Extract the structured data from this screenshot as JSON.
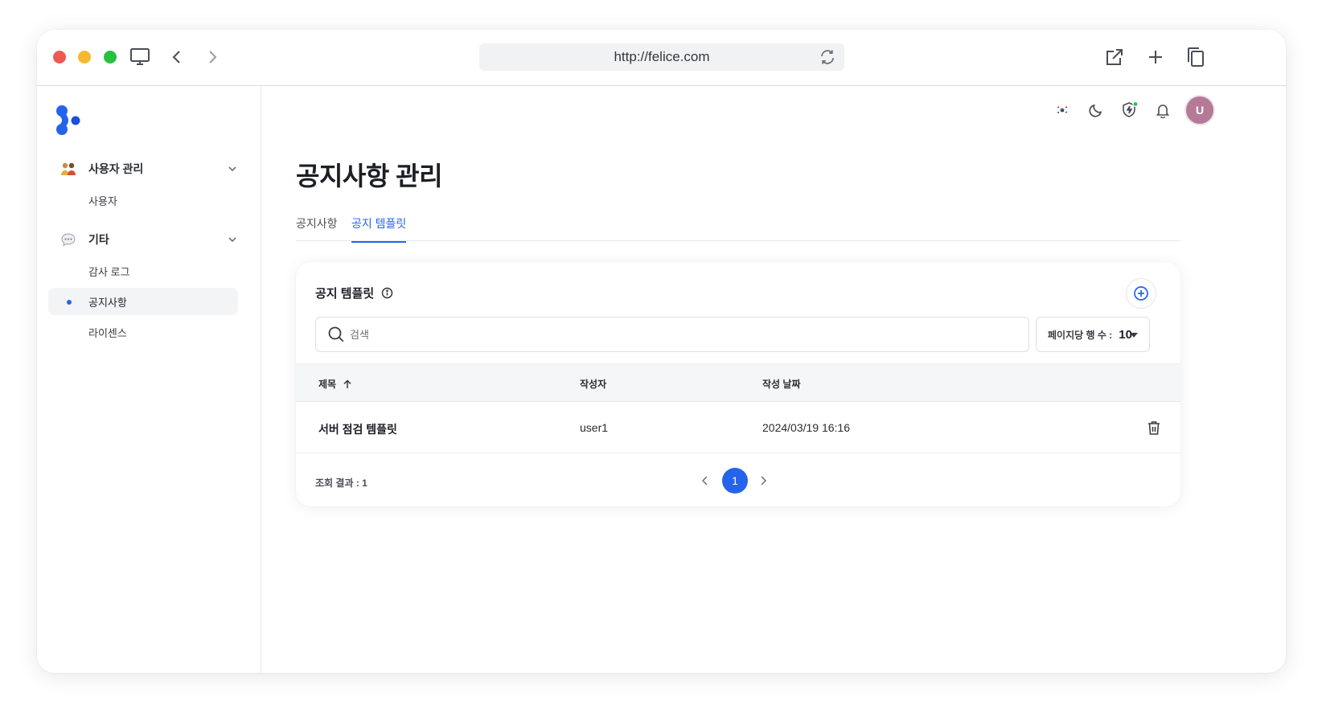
{
  "browser": {
    "url": "http://felice.com",
    "traffic_colors": {
      "close": "#ee5a52",
      "minimize": "#f5b92f",
      "maximize": "#27c03f"
    }
  },
  "sidebar": {
    "groups": [
      {
        "label": "사용자 관리",
        "icon": "people-icon",
        "items": [
          {
            "label": "사용자",
            "active": false
          }
        ]
      },
      {
        "label": "기타",
        "icon": "chat-bubble-icon",
        "items": [
          {
            "label": "감사 로그",
            "active": false
          },
          {
            "label": "공지사항",
            "active": true
          },
          {
            "label": "라이센스",
            "active": false
          }
        ]
      }
    ]
  },
  "header": {
    "avatar_initial": "U",
    "icons": [
      "korea-flag-icon",
      "moon-icon",
      "shield-icon",
      "bell-icon"
    ]
  },
  "page": {
    "title": "공지사항 관리",
    "tabs": [
      {
        "label": "공지사항",
        "active": false
      },
      {
        "label": "공지 템플릿",
        "active": true
      }
    ]
  },
  "card": {
    "title": "공지 템플릿",
    "search_placeholder": "검색",
    "rows_per_page_label": "페이지당 행 수 :",
    "rows_per_page_value": "10",
    "columns": [
      "제목",
      "작성자",
      "작성 날짜"
    ],
    "rows": [
      {
        "title": "서버 점검 템플릿",
        "author": "user1",
        "date": "2024/03/19 16:16"
      }
    ],
    "result_text": "조회 결과 : 1",
    "current_page": "1"
  },
  "colors": {
    "accent": "#2563eb",
    "avatar": "#b57a98",
    "status_dot": "#22c55e"
  }
}
